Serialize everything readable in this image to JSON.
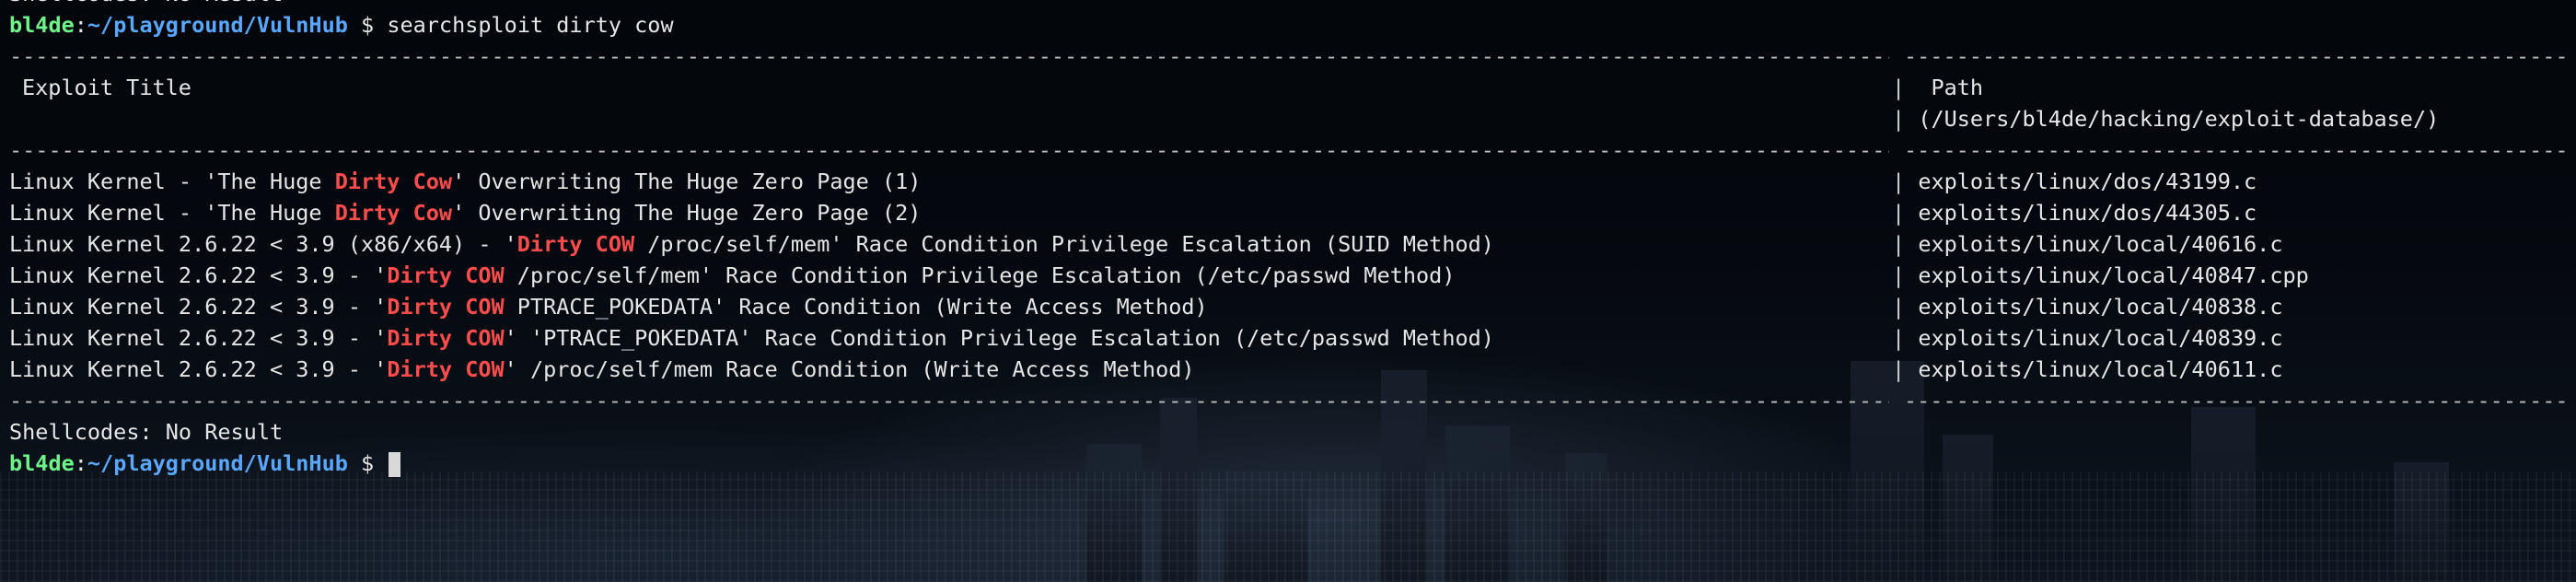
{
  "prev_line": "Shellcodes: No Result",
  "prompt": {
    "host": "bl4de",
    "path": "~/playground/VulnHub",
    "symbol": "$"
  },
  "command": "searchsploit dirty cow",
  "header": {
    "title_col": "Exploit Title",
    "path_col": "Path",
    "path_root": "(/Users/bl4de/hacking/exploit-database/)"
  },
  "results": [
    {
      "pre": "Linux Kernel - 'The Huge ",
      "hl": "Dirty Cow",
      "post": "' Overwriting The Huge Zero Page (1)",
      "path": "exploits/linux/dos/43199.c"
    },
    {
      "pre": "Linux Kernel - 'The Huge ",
      "hl": "Dirty Cow",
      "post": "' Overwriting The Huge Zero Page (2)",
      "path": "exploits/linux/dos/44305.c"
    },
    {
      "pre": "Linux Kernel 2.6.22 < 3.9 (x86/x64) - '",
      "hl": "Dirty COW",
      "post": " /proc/self/mem' Race Condition Privilege Escalation (SUID Method)",
      "path": "exploits/linux/local/40616.c"
    },
    {
      "pre": "Linux Kernel 2.6.22 < 3.9 - '",
      "hl": "Dirty COW",
      "post": " /proc/self/mem' Race Condition Privilege Escalation (/etc/passwd Method)",
      "path": "exploits/linux/local/40847.cpp"
    },
    {
      "pre": "Linux Kernel 2.6.22 < 3.9 - '",
      "hl": "Dirty COW",
      "post": " PTRACE_POKEDATA' Race Condition (Write Access Method)",
      "path": "exploits/linux/local/40838.c"
    },
    {
      "pre": "Linux Kernel 2.6.22 < 3.9 - '",
      "hl": "Dirty COW",
      "post": "' 'PTRACE_POKEDATA' Race Condition Privilege Escalation (/etc/passwd Method)",
      "path": "exploits/linux/local/40839.c"
    },
    {
      "pre": "Linux Kernel 2.6.22 < 3.9 - '",
      "hl": "Dirty COW",
      "post": "' /proc/self/mem Race Condition (Write Access Method)",
      "path": "exploits/linux/local/40611.c"
    }
  ],
  "shellcodes": "Shellcodes: No Result",
  "colors": {
    "prompt_host": "#6ef58a",
    "prompt_path": "#5aa7ff",
    "highlight": "#ff4d4d",
    "text": "#e6e6e6"
  }
}
